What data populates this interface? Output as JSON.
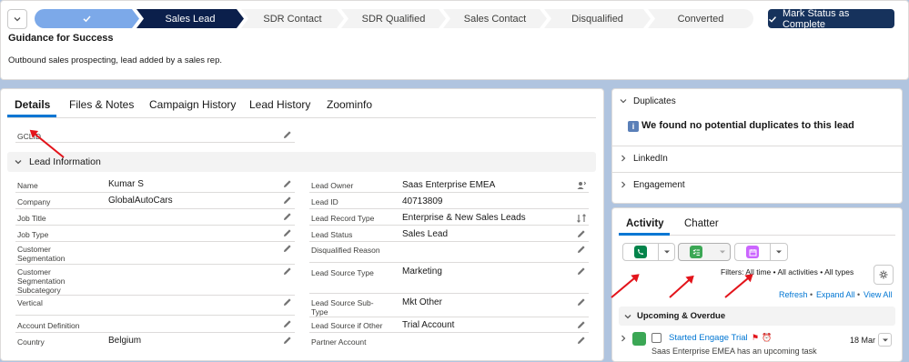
{
  "path": {
    "stages": [
      {
        "label": "",
        "state": "complete"
      },
      {
        "label": "Sales Lead",
        "state": "current"
      },
      {
        "label": "SDR Contact",
        "state": "incomplete"
      },
      {
        "label": "SDR Qualified",
        "state": "incomplete"
      },
      {
        "label": "Sales Contact",
        "state": "incomplete"
      },
      {
        "label": "Disqualified",
        "state": "incomplete"
      },
      {
        "label": "Converted",
        "state": "incomplete"
      }
    ],
    "mark_button": "Mark Status as Complete"
  },
  "guidance": {
    "title": "Guidance for Success",
    "text": "Outbound sales prospecting, lead added by a sales rep."
  },
  "tabs": [
    "Details",
    "Files & Notes",
    "Campaign History",
    "Lead History",
    "Zoominfo"
  ],
  "gclid_label": "GCLID",
  "section_title": "Lead Information",
  "left_fields": [
    {
      "label": "Name",
      "value": "Kumar S"
    },
    {
      "label": "Company",
      "value": "GlobalAutoCars"
    },
    {
      "label": "Job Title",
      "value": ""
    },
    {
      "label": "Job Type",
      "value": ""
    },
    {
      "label": "Customer Segmentation",
      "value": ""
    },
    {
      "label": "Customer Segmentation Subcategory",
      "value": ""
    },
    {
      "label": "Vertical",
      "value": ""
    },
    {
      "label": "Account Definition",
      "value": ""
    },
    {
      "label": "Country",
      "value": "Belgium"
    }
  ],
  "right_fields": [
    {
      "label": "Lead Owner",
      "value": "Saas Enterprise EMEA"
    },
    {
      "label": "Lead ID",
      "value": "40713809"
    },
    {
      "label": "Lead Record Type",
      "value": "Enterprise & New Sales Leads"
    },
    {
      "label": "Lead Status",
      "value": "Sales Lead"
    },
    {
      "label": "Disqualified Reason",
      "value": ""
    },
    {
      "label": "Lead Source Type",
      "value": "Marketing"
    },
    {
      "label": "Lead Source Sub-Type",
      "value": "Mkt Other"
    },
    {
      "label": "Lead Source if Other",
      "value": "Trial Account"
    },
    {
      "label": "Partner Account",
      "value": ""
    }
  ],
  "duplicates": {
    "title": "Duplicates",
    "message": "We found no potential duplicates to this lead"
  },
  "linkedin": "LinkedIn",
  "engagement": "Engagement",
  "activity": {
    "tabs": [
      "Activity",
      "Chatter"
    ],
    "filters": "Filters: All time • All activities • All types",
    "refresh": "Refresh",
    "expand_all": "Expand All",
    "view_all": "View All",
    "upcoming": "Upcoming & Overdue",
    "item_title": "Started Engage Trial",
    "item_date": "18 Mar",
    "item_sub": "Saas Enterprise EMEA has an upcoming task"
  },
  "colors": {
    "path_complete": "#7ca9e9",
    "path_current": "#0b1f4b",
    "brand": "#0176d3",
    "call_icon": "#04844b",
    "task_icon": "#3ba755",
    "event_icon": "#cb65ff",
    "annotation_arrow": "#e3141b"
  }
}
